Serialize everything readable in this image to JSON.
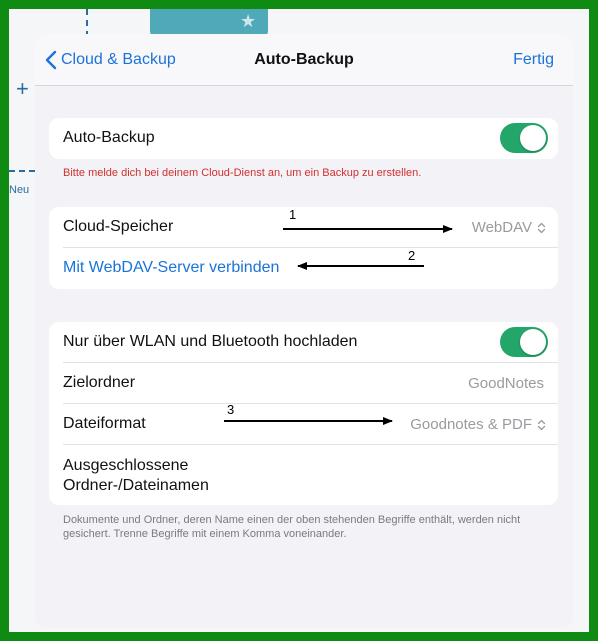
{
  "background": {
    "new_label": "Neu",
    "plus": "+",
    "star": "★",
    "accent_color": "#2d6b9e",
    "frame_color": "#0f8a12"
  },
  "navbar": {
    "back_label": "Cloud & Backup",
    "title": "Auto-Backup",
    "done_label": "Fertig"
  },
  "auto_backup": {
    "label": "Auto-Backup",
    "enabled": true,
    "error": "Bitte melde dich bei deinem Cloud-Dienst an, um ein Backup zu erstellen."
  },
  "cloud": {
    "storage_label": "Cloud-Speicher",
    "storage_value": "WebDAV",
    "connect_label": "Mit WebDAV-Server verbinden"
  },
  "settings": {
    "wifi_label": "Nur über WLAN und Bluetooth hochladen",
    "wifi_enabled": true,
    "folder_label": "Zielordner",
    "folder_value": "GoodNotes",
    "format_label": "Dateiformat",
    "format_value": "Goodnotes & PDF",
    "excluded_label_line1": "Ausgeschlossene",
    "excluded_label_line2": "Ordner-/Dateinamen",
    "footer": "Dokumente und Ordner, deren Name einen der oben stehenden Begriffe enthält, werden nicht gesichert. Trenne Begriffe mit einem Komma voneinander."
  },
  "annotations": {
    "one": "1",
    "two": "2",
    "three": "3"
  },
  "colors": {
    "accent_blue": "#1a73d9",
    "toggle_green": "#23a66a",
    "error_red": "#d0312d"
  }
}
